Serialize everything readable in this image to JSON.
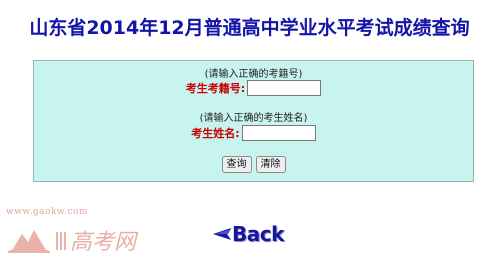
{
  "page": {
    "title": "山东省2014年12月普通高中学业水平考试成绩查询"
  },
  "form": {
    "exam_id_hint": "(请输入正确的考籍号)",
    "exam_id_label": "考生考籍号:",
    "exam_id_value": "",
    "name_hint": "(请输入正确的考生姓名)",
    "name_label": "考生姓名:",
    "name_value": "",
    "query_button": "查询",
    "clear_button": "清除"
  },
  "watermark": {
    "site": "www.gaokw.com",
    "brand": "高考网"
  },
  "nav": {
    "back_label": "Back",
    "back_icon": "triangle-left-icon"
  },
  "colors": {
    "title": "#1414a6",
    "panel_bg": "#c7f4ef",
    "label": "#cc0000",
    "back": "#16169a",
    "watermark": "#e7a69b"
  }
}
